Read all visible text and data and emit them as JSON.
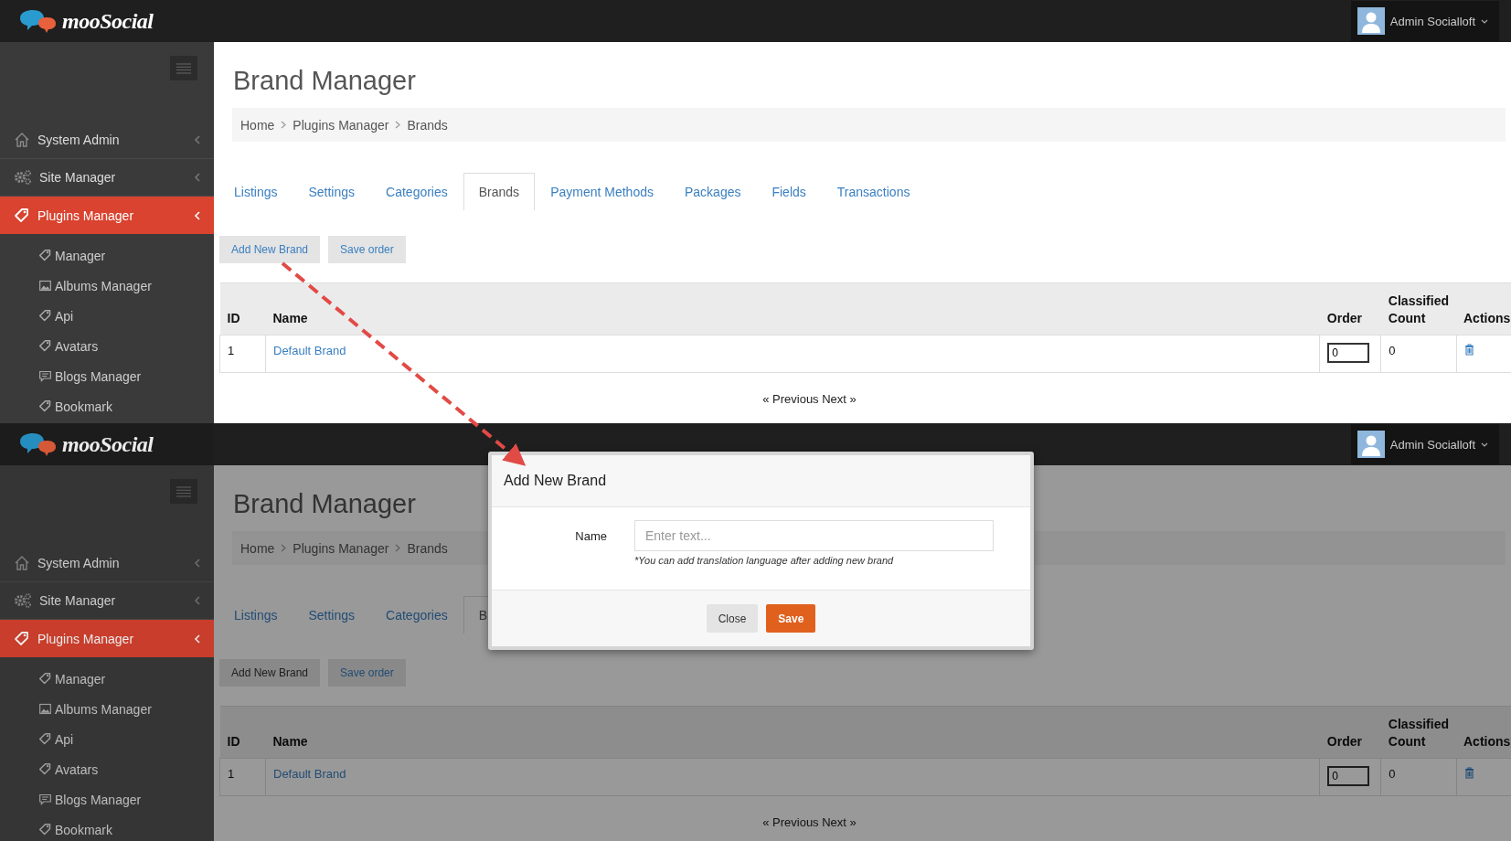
{
  "screens": [
    {
      "dimmed": false,
      "header": {
        "logo": "mooSocial",
        "user": "Admin Socialloft"
      },
      "sidebar": {
        "items": [
          {
            "label": "System Admin",
            "kind": "home",
            "selected": false
          },
          {
            "label": "Site Manager",
            "kind": "gears",
            "selected": false
          },
          {
            "label": "Plugins Manager",
            "kind": "tag",
            "selected": true
          }
        ],
        "subitems": [
          {
            "label": "Manager",
            "kind": "tag"
          },
          {
            "label": "Albums Manager",
            "kind": "image"
          },
          {
            "label": "Api",
            "kind": "tag"
          },
          {
            "label": "Avatars",
            "kind": "tag"
          },
          {
            "label": "Blogs Manager",
            "kind": "comment"
          },
          {
            "label": "Bookmark",
            "kind": "tag"
          }
        ]
      },
      "page_title": "Brand Manager",
      "breadcrumb": [
        "Home",
        "Plugins Manager",
        "Brands"
      ],
      "tabs": [
        {
          "label": "Listings",
          "selected": false
        },
        {
          "label": "Settings",
          "selected": false
        },
        {
          "label": "Categories",
          "selected": false
        },
        {
          "label": "Brands",
          "selected": true
        },
        {
          "label": "Payment Methods",
          "selected": false
        },
        {
          "label": "Packages",
          "selected": false
        },
        {
          "label": "Fields",
          "selected": false
        },
        {
          "label": "Transactions",
          "selected": false
        }
      ],
      "buttons": [
        {
          "label": "Add New Brand",
          "active": false
        },
        {
          "label": "Save order",
          "active": false
        }
      ],
      "table": {
        "columns": [
          "ID",
          "Name",
          "Order",
          "Classified Count",
          "Actions"
        ],
        "rows": [
          {
            "id": "1",
            "name": "Default Brand",
            "order": "0",
            "classified_count": "0"
          }
        ]
      },
      "pagination": "« Previous Next »"
    },
    {
      "dimmed": true,
      "header": {
        "logo": "mooSocial",
        "user": "Admin Socialloft"
      },
      "sidebar": {
        "items": [
          {
            "label": "System Admin",
            "kind": "home",
            "selected": false
          },
          {
            "label": "Site Manager",
            "kind": "gears",
            "selected": false
          },
          {
            "label": "Plugins Manager",
            "kind": "tag",
            "selected": true
          }
        ],
        "subitems": [
          {
            "label": "Manager",
            "kind": "tag"
          },
          {
            "label": "Albums Manager",
            "kind": "image"
          },
          {
            "label": "Api",
            "kind": "tag"
          },
          {
            "label": "Avatars",
            "kind": "tag"
          },
          {
            "label": "Blogs Manager",
            "kind": "comment"
          },
          {
            "label": "Bookmark",
            "kind": "tag"
          }
        ]
      },
      "page_title": "Brand Manager",
      "breadcrumb": [
        "Home",
        "Plugins Manager",
        "Brands"
      ],
      "tabs": [
        {
          "label": "Listings",
          "selected": false
        },
        {
          "label": "Settings",
          "selected": false
        },
        {
          "label": "Categories",
          "selected": false
        },
        {
          "label": "B",
          "selected": true
        }
      ],
      "buttons": [
        {
          "label": "Add New Brand",
          "active": true
        },
        {
          "label": "Save order",
          "active": false
        }
      ],
      "table": {
        "columns": [
          "ID",
          "Name",
          "Order",
          "Classified Count",
          "Actions"
        ],
        "rows": [
          {
            "id": "1",
            "name": "Default Brand",
            "order": "0",
            "classified_count": "0"
          }
        ]
      },
      "pagination": "« Previous Next »",
      "modal": {
        "title": "Add New Brand",
        "field_label": "Name",
        "placeholder": "Enter text...",
        "hint": "*You can add translation language after adding new brand",
        "buttons": [
          {
            "label": "Close",
            "kind": "default"
          },
          {
            "label": "Save",
            "kind": "primary"
          }
        ]
      }
    }
  ]
}
